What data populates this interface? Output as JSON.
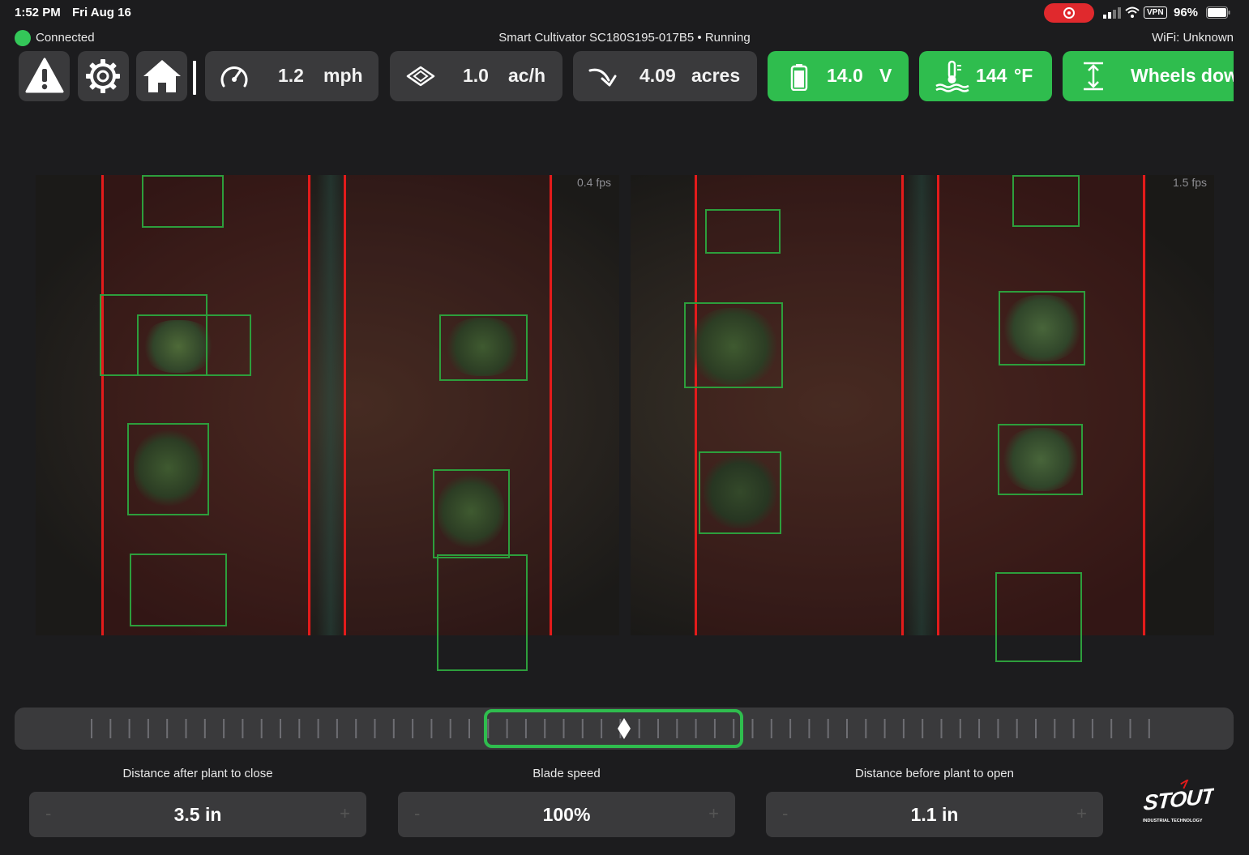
{
  "status_bar": {
    "time": "1:52 PM",
    "date": "Fri Aug 16",
    "vpn": "VPN",
    "battery": "96%"
  },
  "connection": {
    "status": "Connected",
    "machine": "Smart Cultivator SC180S195-017B5 • Running",
    "wifi": "WiFi: Unknown"
  },
  "toolbar": {
    "icons": [
      "warning-icon",
      "gear-icon",
      "home-icon"
    ],
    "speed": {
      "value": "1.2",
      "unit": "mph"
    },
    "rate": {
      "value": "1.0",
      "unit": "ac/h"
    },
    "area": {
      "value": "4.09",
      "unit": "acres"
    },
    "voltage": {
      "value": "14.0",
      "unit": "V"
    },
    "temperature": {
      "value": "144",
      "unit": "°F"
    },
    "wheels": "Wheels dow"
  },
  "cameras": {
    "left_fps": "0.4 fps",
    "right_fps": "1.5 fps"
  },
  "controls": {
    "close_distance": {
      "label": "Distance after plant to close",
      "value": "3.5 in",
      "minus": "-",
      "plus": "+"
    },
    "blade_speed": {
      "label": "Blade speed",
      "value": "100%",
      "minus": "-",
      "plus": "+"
    },
    "open_distance": {
      "label": "Distance before plant to open",
      "value": "1.1 in",
      "minus": "-",
      "plus": "+"
    }
  },
  "logo": {
    "text": "STOUT",
    "subtitle": "INDUSTRIAL TECHNOLOGY"
  },
  "colors": {
    "accent_green": "#2fbd4e",
    "connected": "#34c759",
    "lane_red": "#e31b1b",
    "box_green": "#2d9e3c"
  }
}
